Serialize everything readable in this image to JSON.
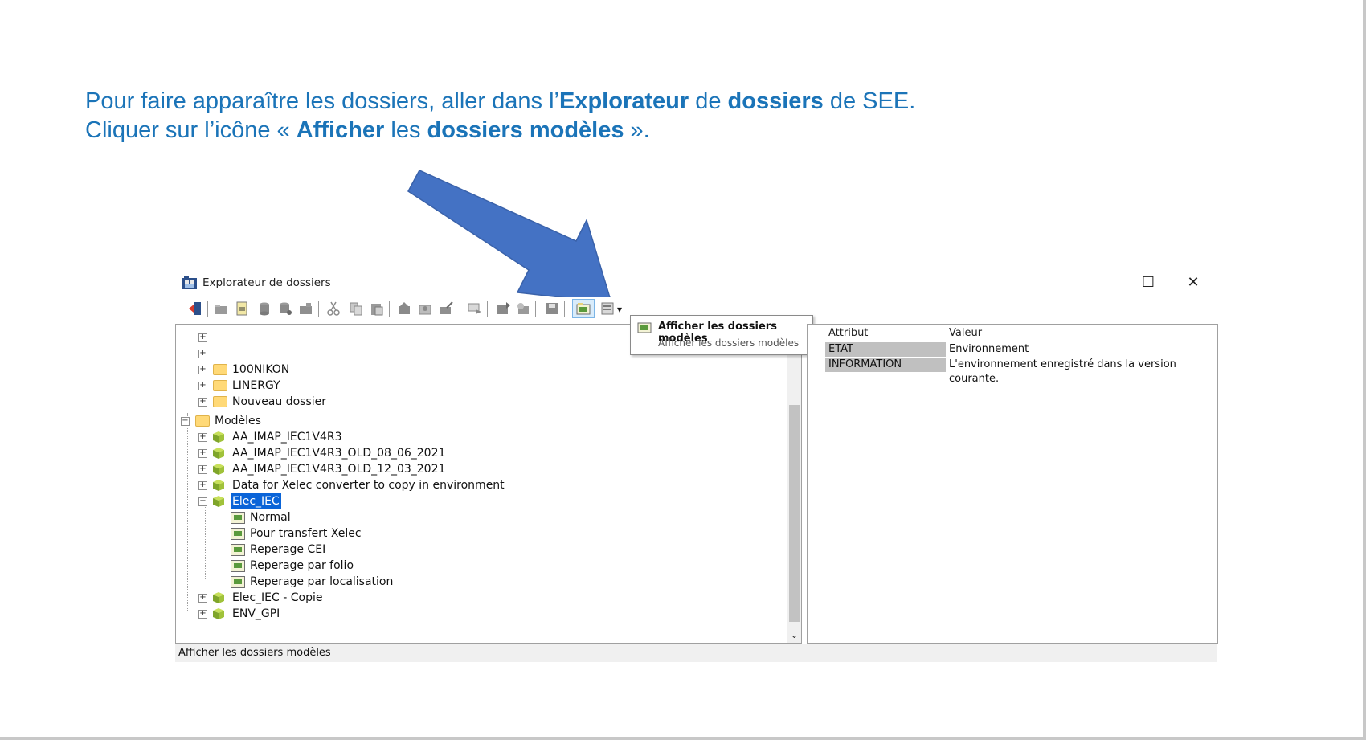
{
  "instructions": {
    "line1": {
      "before": "Pour faire apparaître les dossiers, aller dans l’",
      "bold1": "Explorateur",
      "mid": " de ",
      "bold2": "dossiers",
      "after": " de SEE."
    },
    "line2": {
      "before": "Cliquer sur l’icône « ",
      "bold1": "Afficher",
      "mid": " les ",
      "bold2": "dossiers modèles",
      "after": " »."
    }
  },
  "colors": {
    "text_blue": "#1b74b8",
    "arrow_blue": "#4472c4",
    "selection": "#0a64d8"
  },
  "window": {
    "title": "Explorateur de dossiers",
    "maximize_glyph": "☐",
    "close_glyph": "✕",
    "app_icon": "explorer-app-icon"
  },
  "toolbar": {
    "dropdown_glyph": "▾",
    "active_button": "afficher-dossiers-modeles"
  },
  "tooltip": {
    "title": "Afficher les dossiers modèles",
    "description": "Afficher les dossiers modèles"
  },
  "tree": {
    "items": [
      {
        "label": "",
        "icon": "none"
      },
      {
        "label": "",
        "icon": "none"
      },
      {
        "label": "100NIKON",
        "icon": "folder-icon"
      },
      {
        "label": "LINERGY",
        "icon": "folder-icon"
      },
      {
        "label": "Nouveau dossier",
        "icon": "folder-icon"
      },
      {
        "label": "Modèles",
        "icon": "folder-icon"
      },
      {
        "label": "AA_IMAP_IEC1V4R3",
        "icon": "model-box-icon"
      },
      {
        "label": "AA_IMAP_IEC1V4R3_OLD_08_06_2021",
        "icon": "model-box-icon"
      },
      {
        "label": "AA_IMAP_IEC1V4R3_OLD_12_03_2021",
        "icon": "model-box-icon"
      },
      {
        "label": "Data for Xelec converter to copy in environment",
        "icon": "model-box-icon"
      },
      {
        "label": "Elec_IEC",
        "icon": "model-box-icon"
      },
      {
        "label": "Normal",
        "icon": "sub-model-icon"
      },
      {
        "label": "Pour transfert Xelec",
        "icon": "sub-model-icon"
      },
      {
        "label": "Reperage CEI",
        "icon": "sub-model-icon"
      },
      {
        "label": "Reperage par folio",
        "icon": "sub-model-icon"
      },
      {
        "label": "Reperage par localisation",
        "icon": "sub-model-icon"
      },
      {
        "label": "Elec_IEC - Copie",
        "icon": "model-box-icon"
      },
      {
        "label": "ENV_GPI",
        "icon": "model-box-icon"
      }
    ],
    "expander_plus": "+",
    "expander_minus": "−",
    "scroll_down_glyph": "⌄"
  },
  "properties": {
    "header_attribute": "Attribut",
    "header_value": "Valeur",
    "rows": [
      {
        "key": "ETAT",
        "value": "Environnement"
      },
      {
        "key": "INFORMATION",
        "value": "L'environnement enregistré dans la version courante."
      }
    ]
  },
  "status": {
    "text": "Afficher les dossiers modèles"
  }
}
